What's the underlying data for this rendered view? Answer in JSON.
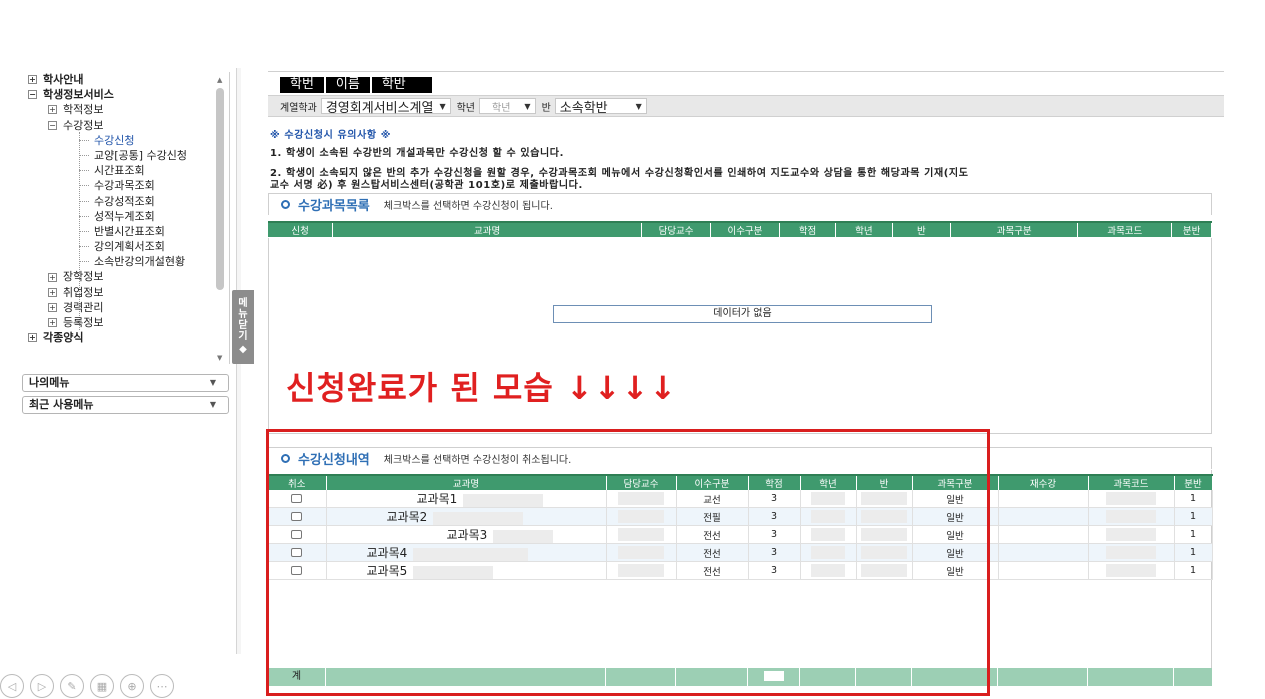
{
  "sidebar": {
    "tree": [
      {
        "label": "학사안내",
        "level": 0,
        "toggle": "+"
      },
      {
        "label": "학생정보서비스",
        "level": 0,
        "toggle": "−"
      },
      {
        "label": "학적정보",
        "level": 1,
        "toggle": "+"
      },
      {
        "label": "수강정보",
        "level": 1,
        "toggle": "−"
      },
      {
        "label": "수강신청",
        "level": 2,
        "active": true
      },
      {
        "label": "교양[공통] 수강신청",
        "level": 2
      },
      {
        "label": "시간표조회",
        "level": 2
      },
      {
        "label": "수강과목조회",
        "level": 2
      },
      {
        "label": "수강성적조회",
        "level": 2
      },
      {
        "label": "성적누계조회",
        "level": 2
      },
      {
        "label": "반별시간표조회",
        "level": 2
      },
      {
        "label": "강의계획서조회",
        "level": 2
      },
      {
        "label": "소속반강의개설현황",
        "level": 2
      },
      {
        "label": "장학정보",
        "level": 1,
        "toggle": "+"
      },
      {
        "label": "취업정보",
        "level": 1,
        "toggle": "+"
      },
      {
        "label": "경력관리",
        "level": 1,
        "toggle": "+"
      },
      {
        "label": "등록정보",
        "level": 1,
        "toggle": "+"
      },
      {
        "label": "각종양식",
        "level": 0,
        "toggle": "+"
      }
    ],
    "my_menu": "나의메뉴",
    "recent_menu": "최근 사용메뉴",
    "toggle_label": "메뉴닫기"
  },
  "student_bar": {
    "student_no": "학번",
    "name": "이름",
    "class": "학반"
  },
  "filters": {
    "dept_label": "계열학과",
    "dept_value": "경영회계서비스계열",
    "grade_label": "학년",
    "grade_value": "학년",
    "class_label": "반",
    "class_value": "소속학반"
  },
  "notice": {
    "title": "※ 수강신청시 유의사항 ※",
    "line1": "1. 학생이 소속된 수강반의 개설과목만 수강신청 할 수 있습니다.",
    "line2a": "2. 학생이 소속되지 않은 반의 추가 수강신청을 원할 경우, 수강과목조회 메뉴에서 수강신청확인서를 인쇄하여 지도교수와 상담을 통한 해당과목 기재(지도",
    "line2b": "교수 서명 必) 후 원스탑서비스센터(공학관 101호)로 제출바랍니다."
  },
  "course_list": {
    "title": "수강과목목록",
    "hint": "체크박스를 선택하면 수강신청이 됩니다.",
    "columns": [
      "신청",
      "교과명",
      "담당교수",
      "이수구분",
      "학점",
      "학년",
      "반",
      "과목구분",
      "과목코드",
      "분반"
    ],
    "empty_message": "데이터가 없음"
  },
  "annotation": "신청완료가 된 모습 ↓↓↓↓",
  "enrolled": {
    "title": "수강신청내역",
    "hint": "체크박스를 선택하면 수강신청이 취소됩니다.",
    "columns": [
      "취소",
      "교과명",
      "담당교수",
      "이수구분",
      "학점",
      "학년",
      "반",
      "과목구분",
      "재수강",
      "과목코드",
      "분반"
    ],
    "rows": [
      {
        "name": "교과목1",
        "type": "교선",
        "credit": "3",
        "category": "일반",
        "section": "1"
      },
      {
        "name": "교과목2",
        "type": "전필",
        "credit": "3",
        "category": "일반",
        "section": "1"
      },
      {
        "name": "교과목3",
        "type": "전선",
        "credit": "3",
        "category": "일반",
        "section": "1"
      },
      {
        "name": "교과목4",
        "type": "전선",
        "credit": "3",
        "category": "일반",
        "section": "1"
      },
      {
        "name": "교과목5",
        "type": "전선",
        "credit": "3",
        "category": "일반",
        "section": "1"
      }
    ],
    "total_label": "계"
  },
  "colors": {
    "header_green": "#3f9a6e",
    "accent_blue": "#2f6fb5",
    "annot_red": "#e02020"
  }
}
